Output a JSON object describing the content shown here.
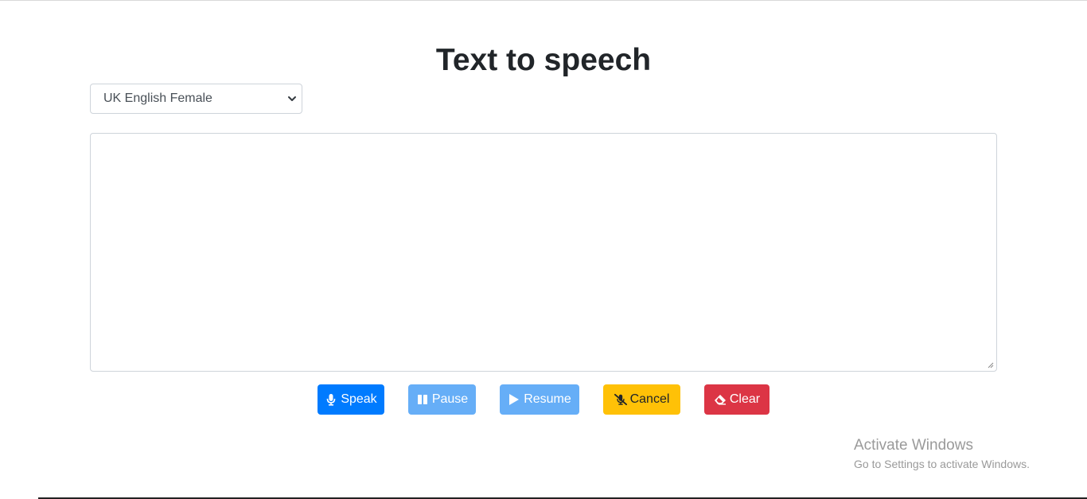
{
  "header": {
    "title": "Text to speech"
  },
  "voice_select": {
    "selected": "UK English Female"
  },
  "textarea": {
    "value": ""
  },
  "buttons": {
    "speak": "Speak",
    "pause": "Pause",
    "resume": "Resume",
    "cancel": "Cancel",
    "clear": "Clear"
  },
  "watermark": {
    "title": "Activate Windows",
    "subtitle": "Go to Settings to activate Windows."
  },
  "colors": {
    "primary": "#007bff",
    "primary_disabled": "#66aef7",
    "warning": "#ffc107",
    "danger": "#dc3545"
  }
}
